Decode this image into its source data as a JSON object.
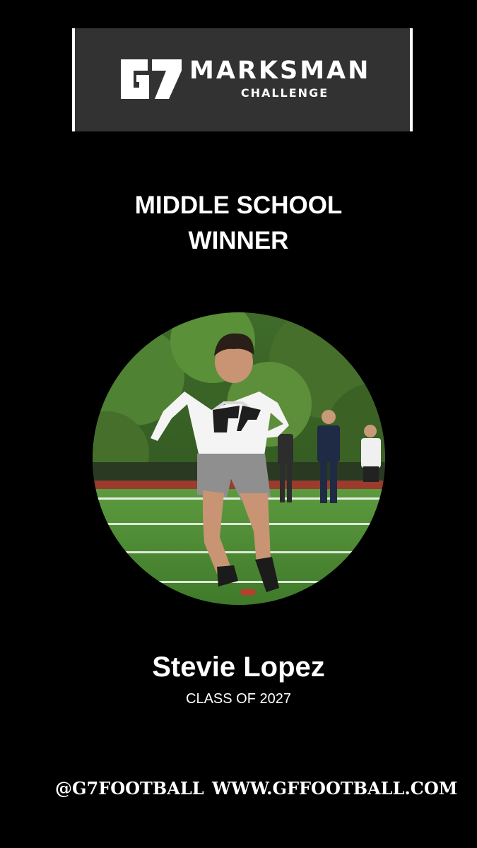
{
  "banner": {
    "logo_icon": "g7-logo-icon",
    "title": "MARKSMAN",
    "subtitle": "CHALLENGE"
  },
  "award": {
    "line1": "MIDDLE SCHOOL",
    "line2": "WINNER"
  },
  "photo": {
    "subject": "athlete-photo"
  },
  "athlete": {
    "name": "Stevie Lopez",
    "class_year": "CLASS OF 2027"
  },
  "footer": {
    "handle": "@G7FOOTBALL",
    "website": "WWW.GFFOOTBALL.COM"
  },
  "colors": {
    "background": "#000000",
    "banner": "#323232",
    "text": "#ffffff"
  }
}
